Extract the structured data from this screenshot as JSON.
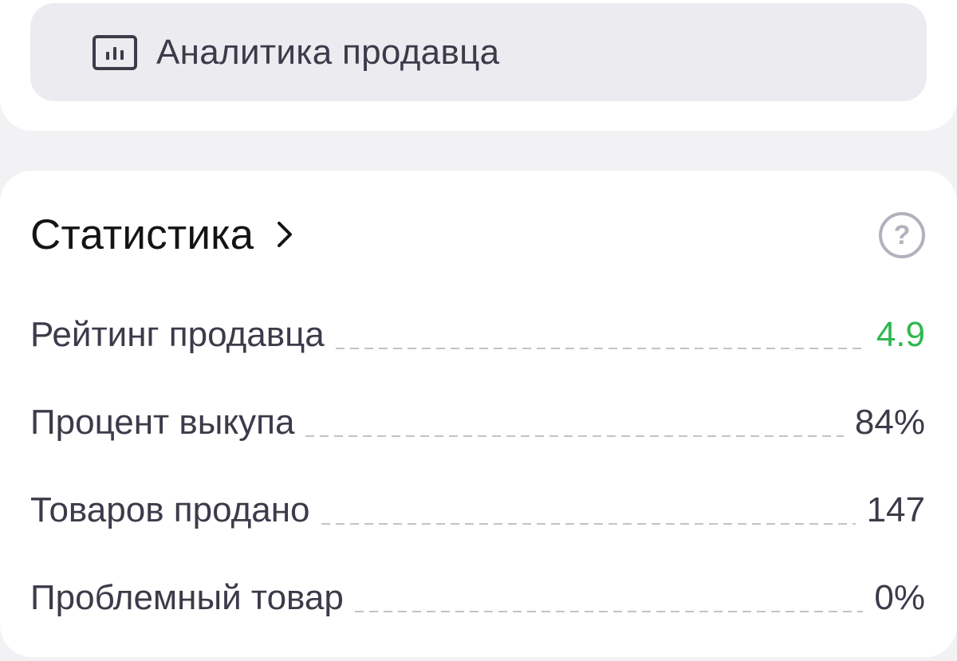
{
  "analytics": {
    "label": "Аналитика продавца",
    "icon": "bar-chart-icon"
  },
  "stats": {
    "title": "Статистика",
    "chevron_icon": "chevron-right-icon",
    "help_icon": "question-circle-icon",
    "help_glyph": "?",
    "rows": [
      {
        "label": "Рейтинг продавца",
        "value": "4.9",
        "value_color": "#2eb84f"
      },
      {
        "label": "Процент выкупа",
        "value": "84%"
      },
      {
        "label": "Товаров продано",
        "value": "147"
      },
      {
        "label": "Проблемный товар",
        "value": "0%"
      }
    ]
  },
  "colors": {
    "background": "#f2f2f5",
    "card": "#ffffff",
    "button_bg": "#ececf0",
    "text_primary": "#3d3a4a",
    "title": "#141414",
    "accent_good": "#2eb84f",
    "muted": "#b3b1bd"
  }
}
